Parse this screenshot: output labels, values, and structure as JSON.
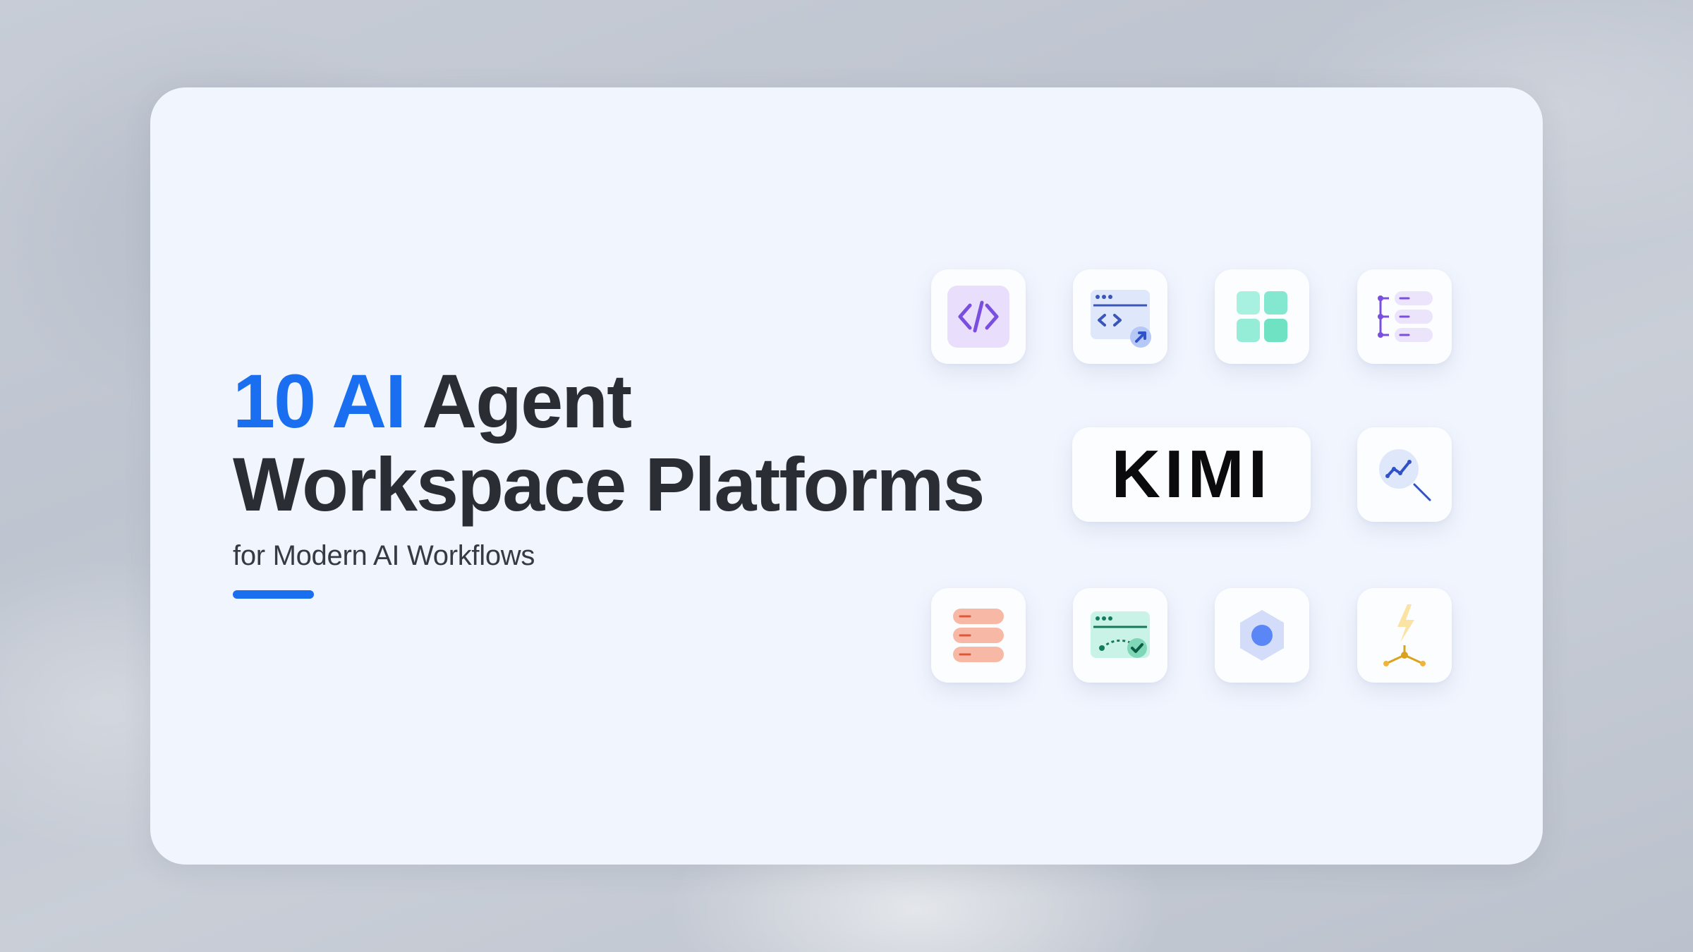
{
  "title": {
    "accent": "10 AI",
    "line1_rest": "Agent",
    "line2": "Workspace Platforms"
  },
  "subtitle": "for Modern AI Workflows",
  "logo": {
    "text": "KIMI"
  },
  "icons": [
    "code-tag-icon",
    "code-window-icon",
    "grid-apps-icon",
    "tree-list-icon",
    "chart-search-icon",
    "server-stack-icon",
    "workflow-check-icon",
    "hexagon-icon",
    "lightning-node-icon"
  ],
  "colors": {
    "accent": "#1a6ff0",
    "title": "#2a2d34",
    "card": "#f1f5fe"
  }
}
